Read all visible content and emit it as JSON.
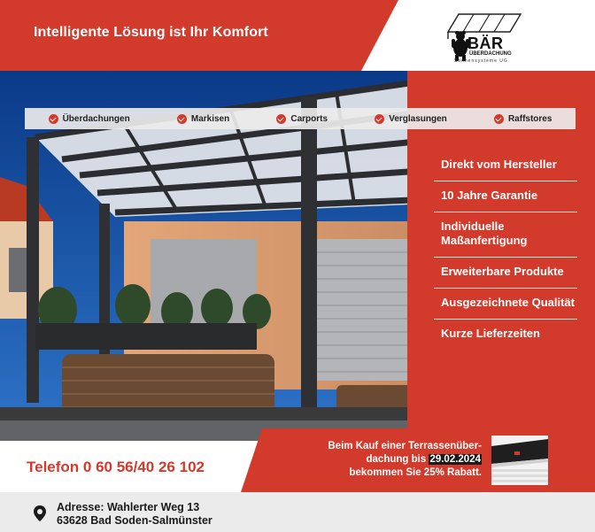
{
  "header": {
    "title": "Intelligente  Lösung ist Ihr Komfort"
  },
  "logo": {
    "name": "BÄR",
    "subtitle": "ÜBERDACHUNG",
    "tagline": "Sonnensysteme UG"
  },
  "nav": {
    "items": [
      {
        "label": "Überdachungen",
        "icon": "check-circle-icon"
      },
      {
        "label": "Markisen",
        "icon": "check-circle-icon"
      },
      {
        "label": "Carports",
        "icon": "check-circle-icon"
      },
      {
        "label": "Verglasungen",
        "icon": "check-circle-icon"
      },
      {
        "label": "Raffstores",
        "icon": "check-circle-icon"
      }
    ]
  },
  "features": [
    "Direkt vom Hersteller",
    "10 Jahre Garantie",
    "Individuelle Maßanfertigung",
    "Erweiterbare Produkte",
    "Ausgezeichnete Qualität",
    "Kurze Lieferzeiten"
  ],
  "contact": {
    "phone": "Telefon 0 60 56/40 26 102",
    "address_line1": "Adresse: Wahlerter Weg 13",
    "address_line2": "63628 Bad Soden-Salmünster"
  },
  "promo": {
    "line1": "Beim Kauf einer Terrassenüber-",
    "line2_prefix": "dachung bis ",
    "date": "29.02.2024",
    "line3": "bekommen Sie 25% Rabatt."
  },
  "colors": {
    "brand_red": "#d23a2b",
    "sky_blue": "#1d5fb8",
    "address_bg": "#ebebeb"
  }
}
